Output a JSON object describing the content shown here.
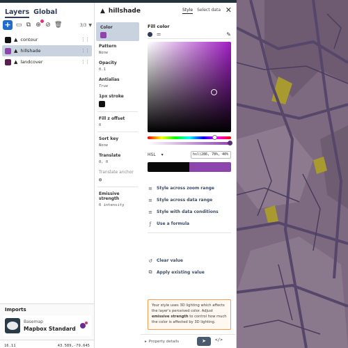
{
  "layers_panel": {
    "tabs": [
      "Layers",
      "Global"
    ],
    "layer_count": "3/3",
    "layers": [
      {
        "name": "contour",
        "swatch": "#111111",
        "selected": false
      },
      {
        "name": "hillshade",
        "swatch": "#8e44ad",
        "selected": true
      },
      {
        "name": "landcover",
        "swatch": "#5b1f52",
        "selected": false
      }
    ],
    "imports": {
      "title": "Imports",
      "subtitle": "Basemap",
      "name": "Mapbox Standard"
    },
    "status": {
      "zoom": "16.11",
      "coords": "43.589,-79.645"
    }
  },
  "props_panel": {
    "layer_title": "hillshade",
    "tabs": [
      "Style",
      "Select data"
    ],
    "properties": [
      {
        "label": "Color",
        "value": "",
        "swatch": "#8e44ad",
        "selected": true
      },
      {
        "label": "Pattern",
        "value": "None"
      },
      {
        "label": "Opacity",
        "value": "0.1"
      },
      {
        "label": "Antialias",
        "value": "True"
      },
      {
        "label": "1px stroke",
        "value": "",
        "swatch": "#111111"
      },
      {
        "label": "Fill z offset",
        "value": "0"
      },
      {
        "label": "Sort key",
        "value": "None"
      },
      {
        "label": "Translate",
        "value": "0, 0"
      },
      {
        "label": "Translate anchor",
        "value": ""
      },
      {
        "label": "Emissive strength",
        "value": "0 intensity"
      }
    ],
    "fill": {
      "title": "Fill color",
      "format": "HSL",
      "value": "hsl(286, 78%, 40%)",
      "old_color": "#0a0a0a",
      "new_color": "#8e44ad",
      "hue_fraction": 0.8,
      "alpha_fraction": 0.99
    },
    "actions": [
      {
        "icon": "zoom-range-icon",
        "glyph": "≡",
        "label": "Style across zoom range"
      },
      {
        "icon": "data-range-icon",
        "glyph": "≡",
        "label": "Style across data range"
      },
      {
        "icon": "data-conditions-icon",
        "glyph": "≡",
        "label": "Style with data conditions"
      },
      {
        "icon": "formula-icon",
        "glyph": "ƒ",
        "label": "Use a formula"
      }
    ],
    "actions2": [
      {
        "icon": "clear-icon",
        "glyph": "↺",
        "label": "Clear value"
      },
      {
        "icon": "apply-existing-icon",
        "glyph": "⧉",
        "label": "Apply existing value"
      }
    ],
    "notice": {
      "text1": "Your style uses 3D lighting which affects the layer's perceived color. Adjust ",
      "bold": "emissive strength",
      "text2": " to control how much the color is affected by 3D lighting."
    },
    "footer": {
      "details": "Property details",
      "code": "</>"
    }
  }
}
